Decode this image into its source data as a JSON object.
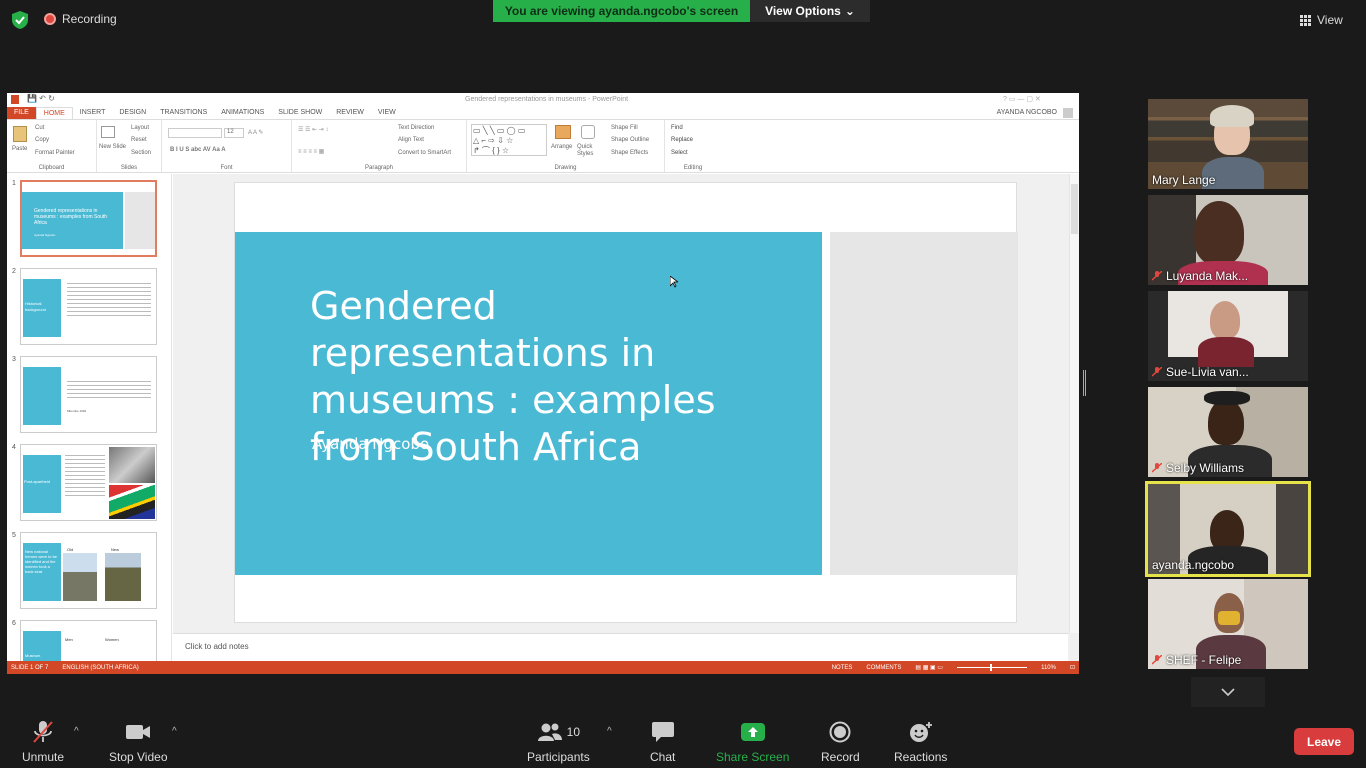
{
  "topbar": {
    "recording_label": "Recording",
    "viewing_banner": "You are viewing ayanda.ngcobo's screen",
    "view_options_label": "View Options",
    "view_label": "View"
  },
  "ppt": {
    "window_title": "Gendered representations in museums - PowerPoint",
    "user_name": "AYANDA NGCOBO",
    "tabs": [
      "FILE",
      "HOME",
      "INSERT",
      "DESIGN",
      "TRANSITIONS",
      "ANIMATIONS",
      "SLIDE SHOW",
      "REVIEW",
      "VIEW"
    ],
    "ribbon": {
      "clipboard": {
        "label": "Clipboard",
        "paste": "Paste",
        "cut": "Cut",
        "copy": "Copy",
        "format_painter": "Format Painter"
      },
      "slides": {
        "label": "Slides",
        "new_slide": "New Slide",
        "layout": "Layout",
        "reset": "Reset",
        "section": "Section"
      },
      "font": {
        "label": "Font",
        "size": "12"
      },
      "paragraph": {
        "label": "Paragraph",
        "text_direction": "Text Direction",
        "align_text": "Align Text",
        "smartart": "Convert to SmartArt"
      },
      "drawing": {
        "label": "Drawing",
        "arrange": "Arrange",
        "quick_styles": "Quick Styles",
        "shape_fill": "Shape Fill",
        "shape_outline": "Shape Outline",
        "shape_effects": "Shape Effects"
      },
      "editing": {
        "label": "Editing",
        "find": "Find",
        "replace": "Replace",
        "select": "Select"
      }
    },
    "thumbnails": [
      {
        "num": "1",
        "title": "Gendered representations in museums : examples from South Africa",
        "sub": "Ayanda Ngcobo"
      },
      {
        "num": "2",
        "title": "Historical background"
      },
      {
        "num": "3",
        "quote_author": "Mbembe 1992"
      },
      {
        "num": "4",
        "title": "Post-apartheid"
      },
      {
        "num": "5",
        "title": "New national heroes were to be identified and the women took a back seat.",
        "col1": "Old",
        "col2": "New"
      },
      {
        "num": "6",
        "title": "Museum",
        "col1": "Men",
        "col2": "Women"
      }
    ],
    "slide": {
      "title": "Gendered representations in museums : examples from South Africa",
      "subtitle": "Ayanda Ngcobo"
    },
    "notes_placeholder": "Click to add notes",
    "status": {
      "slide_count": "SLIDE 1 OF 7",
      "language": "ENGLISH (SOUTH AFRICA)",
      "notes": "NOTES",
      "comments": "COMMENTS",
      "zoom": "110%"
    }
  },
  "participants": [
    {
      "name": "Mary Lange",
      "muted": false
    },
    {
      "name": "Luyanda Mak...",
      "muted": true
    },
    {
      "name": "Sue-Livia van...",
      "muted": true
    },
    {
      "name": "Selby Williams",
      "muted": true
    },
    {
      "name": "ayanda.ngcobo",
      "muted": false,
      "speaking": true
    },
    {
      "name": "SHEF - Felipe",
      "muted": true
    }
  ],
  "toolbar": {
    "unmute": "Unmute",
    "stop_video": "Stop Video",
    "participants": "Participants",
    "participants_count": "10",
    "chat": "Chat",
    "share_screen": "Share Screen",
    "record": "Record",
    "reactions": "Reactions",
    "leave": "Leave"
  },
  "colors": {
    "zoom_green": "#27b04a",
    "ppt_orange": "#d24726",
    "slide_blue": "#4ab9d4",
    "leave_red": "#d93c3c",
    "speaker_outline": "#e5e24a"
  }
}
